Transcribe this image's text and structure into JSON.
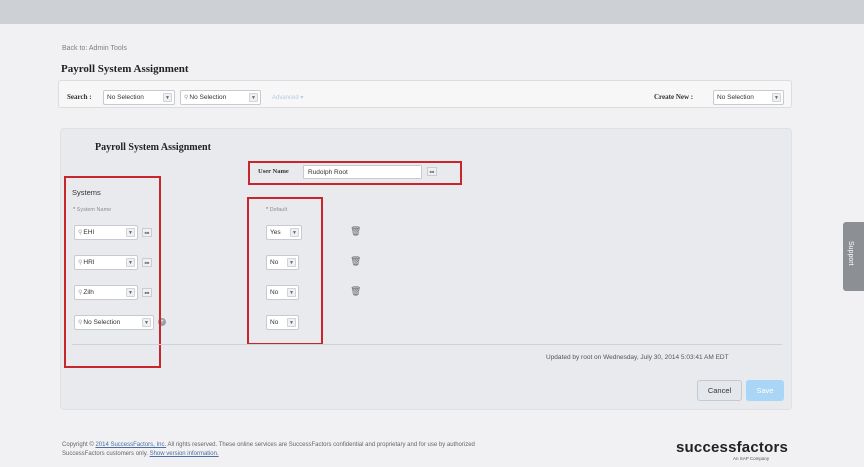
{
  "nav": {
    "back_link": "Back to: Admin Tools"
  },
  "page": {
    "title": "Payroll System Assignment"
  },
  "search": {
    "label": "Search :",
    "type_value": "No Selection",
    "object_value": "No Selection",
    "advanced": "Advanced ▾",
    "create_label": "Create New :",
    "create_value": "No Selection"
  },
  "form": {
    "section_title": "Payroll System Assignment",
    "username_label": "User Name",
    "username_value": "Rudolph Root",
    "systems_label": "Systems",
    "system_name_col": "System Name",
    "default_col": "Default",
    "rows": [
      {
        "system": "EHI",
        "default": "Yes"
      },
      {
        "system": "HRI",
        "default": "No"
      },
      {
        "system": "Zilh",
        "default": "No"
      },
      {
        "system": "No Selection",
        "default": "No"
      }
    ],
    "updated_text": "Updated by root on Wednesday, July 30, 2014 5:03:41 AM EDT",
    "cancel_label": "Cancel",
    "save_label": "Save"
  },
  "footer": {
    "copyright_prefix": "Copyright ©",
    "copyright_link": "2014 SuccessFactors, Inc.",
    "copyright_rest": "All rights reserved. These online services are SuccessFactors confidential and proprietary and for use by authorized",
    "line2_prefix": "SuccessFactors customers only.",
    "version_link": "Show version information."
  },
  "brand": {
    "logo": "successfactors",
    "sub": "An SAP Company"
  },
  "support": {
    "label": "Support"
  },
  "icons": {
    "caret": "chevron-down-icon",
    "search": "search-icon",
    "trash": "trash-icon",
    "picker": "picker-icon",
    "add": "add-circle-icon"
  },
  "colors": {
    "highlight_box": "#c8252c",
    "save_button": "#a9d5f7",
    "link": "#4a6fa0"
  }
}
